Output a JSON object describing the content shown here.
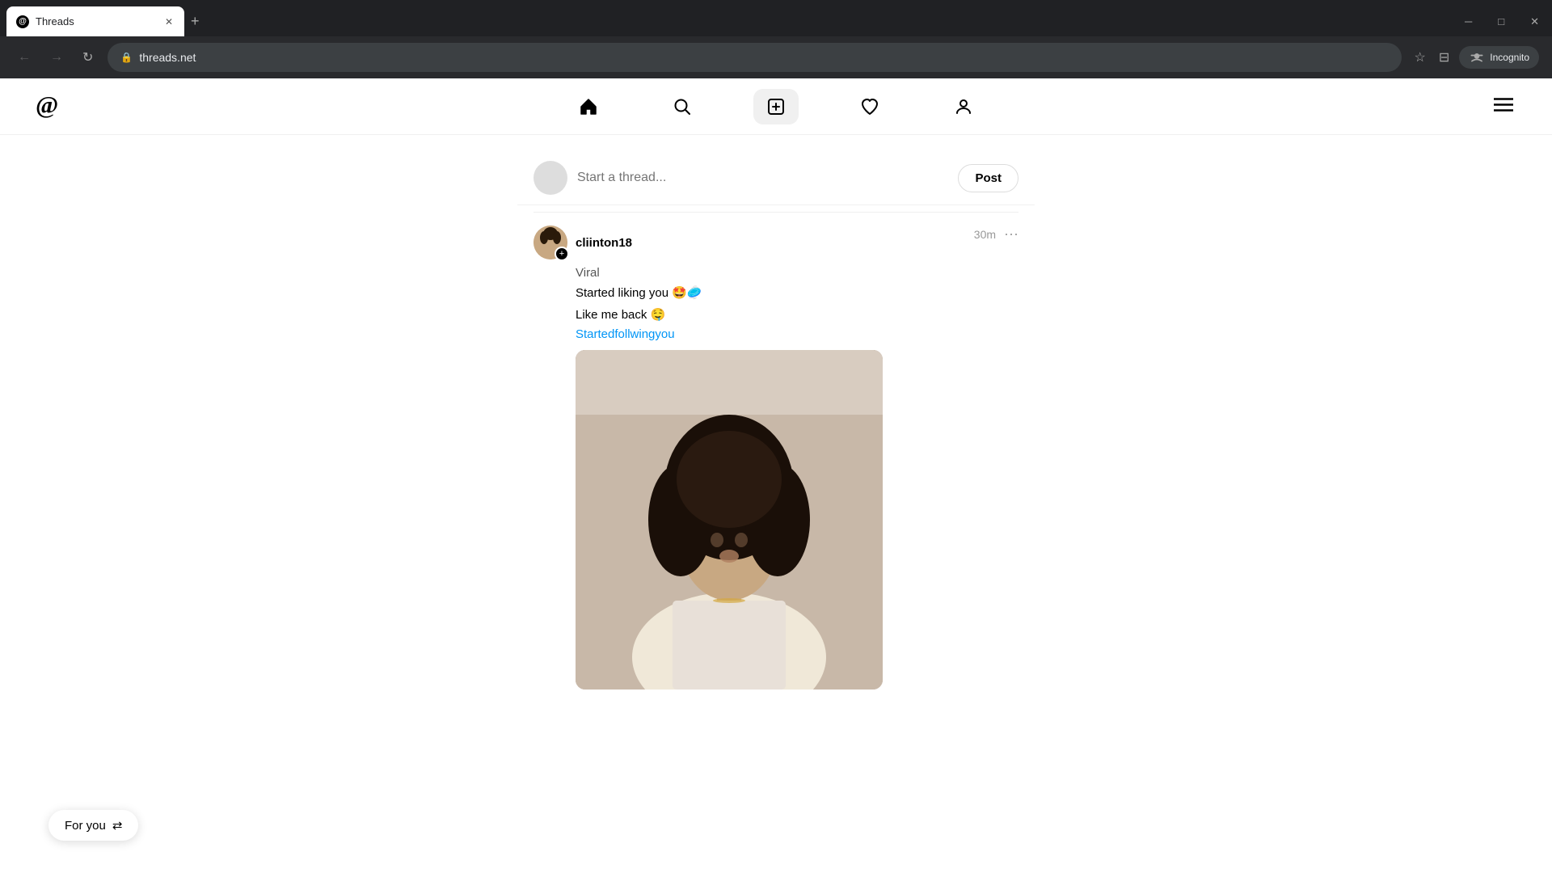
{
  "browser": {
    "tab_title": "Threads",
    "tab_favicon": "@",
    "url": "threads.net",
    "new_tab_label": "+",
    "window_controls": [
      "─",
      "□",
      "✕"
    ],
    "incognito_label": "Incognito",
    "nav": {
      "back_disabled": true,
      "forward_disabled": true
    }
  },
  "app": {
    "logo_alt": "Threads",
    "nav": {
      "home_label": "Home",
      "search_label": "Search",
      "compose_label": "Compose",
      "activity_label": "Activity",
      "profile_label": "Profile",
      "menu_label": "Menu"
    },
    "compose": {
      "placeholder": "Start a thread...",
      "post_button": "Post"
    },
    "post": {
      "username": "cliinton18",
      "time": "30m",
      "tag": "Viral",
      "line1": "Started liking you 🤩🥏",
      "line2": "Like me back 🤤",
      "link_text": "Startedfollwingyou",
      "options_label": "···"
    },
    "for_you": {
      "label": "For you",
      "icon": "⇄"
    }
  }
}
